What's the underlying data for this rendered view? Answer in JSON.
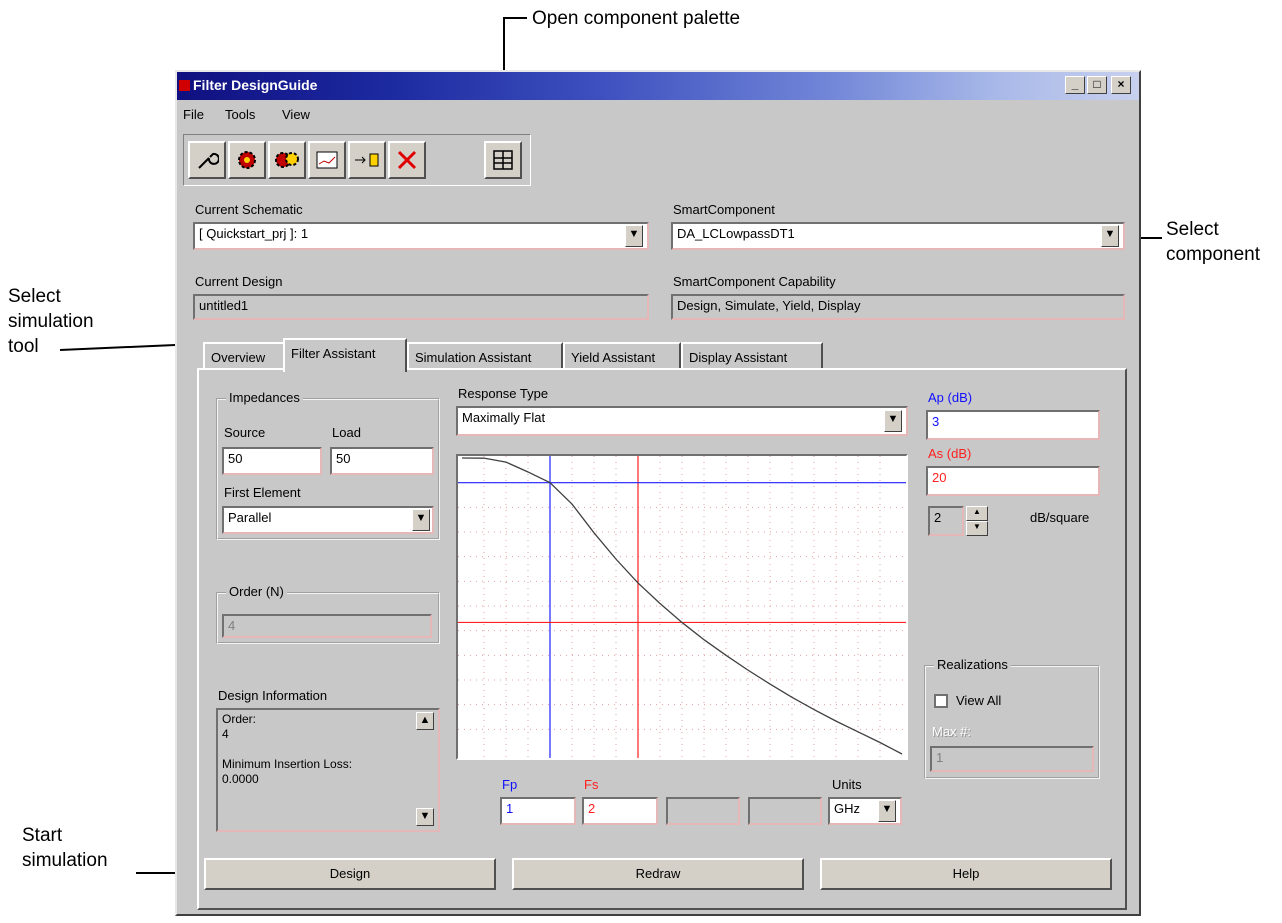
{
  "callouts": {
    "open_palette": "Open component palette",
    "select_component_l1": "Select",
    "select_component_l2": "component",
    "select_sim_l1": "Select",
    "select_sim_l2": "simulation",
    "select_sim_l3": "tool",
    "start_sim_l1": "Start",
    "start_sim_l2": "simulation"
  },
  "window": {
    "title": "Filter DesignGuide",
    "controls": [
      "_",
      "□",
      "×"
    ]
  },
  "menu": [
    "File",
    "Tools",
    "View"
  ],
  "toolbar_icons": [
    "wrench-icon",
    "gear-icon",
    "gears-icon",
    "graph-icon",
    "transfer-icon",
    "delete-icon",
    "palette-icon"
  ],
  "schematic": {
    "label": "Current Schematic",
    "value": "[ Quickstart_prj ]: 1"
  },
  "smart_component": {
    "label": "SmartComponent",
    "value": "DA_LCLowpassDT1"
  },
  "design": {
    "label": "Current Design",
    "value": "untitled1"
  },
  "capability": {
    "label": "SmartComponent Capability",
    "value": "Design, Simulate, Yield, Display"
  },
  "tabs": [
    "Overview",
    "Filter Assistant",
    "Simulation Assistant",
    "Yield Assistant",
    "Display Assistant"
  ],
  "impedances": {
    "title": "Impedances",
    "source_label": "Source",
    "source_value": "50",
    "load_label": "Load",
    "load_value": "50",
    "first_element_label": "First Element",
    "first_element_value": "Parallel"
  },
  "order": {
    "title": "Order (N)",
    "value": "4"
  },
  "design_info": {
    "title": "Design Information",
    "lines": [
      "Order:",
      "4",
      "",
      "Minimum Insertion Loss:",
      "0.0000"
    ]
  },
  "response": {
    "label": "Response Type",
    "value": "Maximally Flat"
  },
  "ap": {
    "label": "Ap (dB)",
    "value": "3",
    "color": "#1010ff"
  },
  "as": {
    "label": "As (dB)",
    "value": "20",
    "color": "#ff2020"
  },
  "slope": {
    "value": "2",
    "unit": "dB/square"
  },
  "realizations": {
    "title": "Realizations",
    "view_all": "View All",
    "max_label": "Max #:",
    "max_value": "1"
  },
  "freq": {
    "fp_label": "Fp",
    "fp_value": "1",
    "fs_label": "Fs",
    "fs_value": "2",
    "units_label": "Units",
    "units_value": "GHz"
  },
  "buttons": {
    "design": "Design",
    "redraw": "Redraw",
    "help": "Help"
  },
  "chart_data": {
    "type": "line",
    "title": "",
    "x": [
      0,
      0.25,
      0.5,
      0.75,
      1.0,
      1.25,
      1.5,
      1.75,
      2.0,
      2.25,
      2.5,
      2.75,
      3.0,
      3.25,
      3.5,
      3.75,
      4.0,
      4.25,
      4.5,
      4.75,
      5.0
    ],
    "series": [
      {
        "values": [
          0,
          0.02,
          0.5,
          1.7,
          3,
          5.6,
          9.1,
          12.3,
          15.2,
          17.7,
          20,
          22.1,
          24,
          25.8,
          27.5,
          29.1,
          30.6,
          32,
          33.3,
          34.6,
          36
        ]
      }
    ],
    "markers": {
      "fp": 1,
      "fs": 2,
      "ap": 3,
      "as": 20
    },
    "grid": true
  }
}
